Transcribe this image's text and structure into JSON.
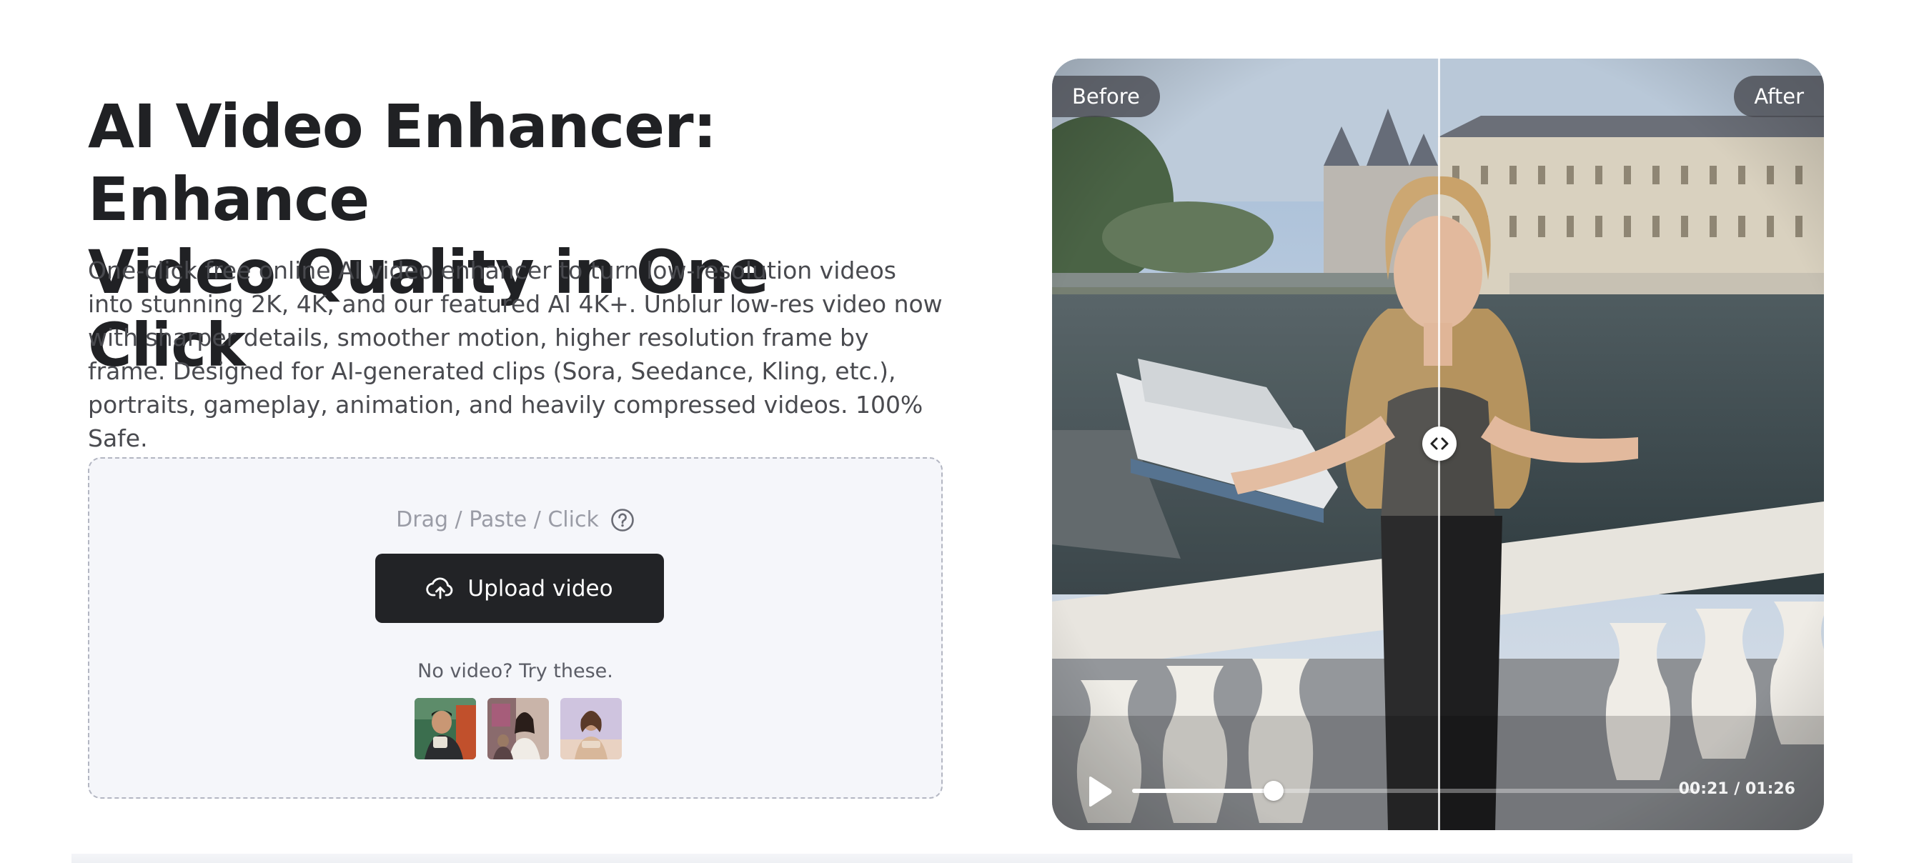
{
  "hero": {
    "title_line1": "AI Video Enhancer: Enhance",
    "title_line2": "Video Quality in One Click",
    "description": "One-click free online AI video enhancer to turn low-resolution videos into stunning 2K, 4K, and our featured AI 4K+. Unblur low-res video now with sharper details, smoother motion, higher resolution frame by frame. Designed for AI-generated clips (Sora, Seedance, Kling, etc.), portraits, gameplay, animation, and heavily compressed videos. 100% Safe."
  },
  "upload": {
    "hint": "Drag / Paste / Click",
    "help_icon": "question-circle-icon",
    "button_label": "Upload video",
    "button_icon": "cloud-upload-icon",
    "try_text": "No video? Try these.",
    "sample_count": 3
  },
  "player": {
    "before_label": "Before",
    "after_label": "After",
    "time_display": "00:21 / 01:26",
    "progress": 0.25,
    "compare_position": 0.5,
    "play_icon": "play-icon",
    "handle_icon": "compare-arrows-icon"
  }
}
